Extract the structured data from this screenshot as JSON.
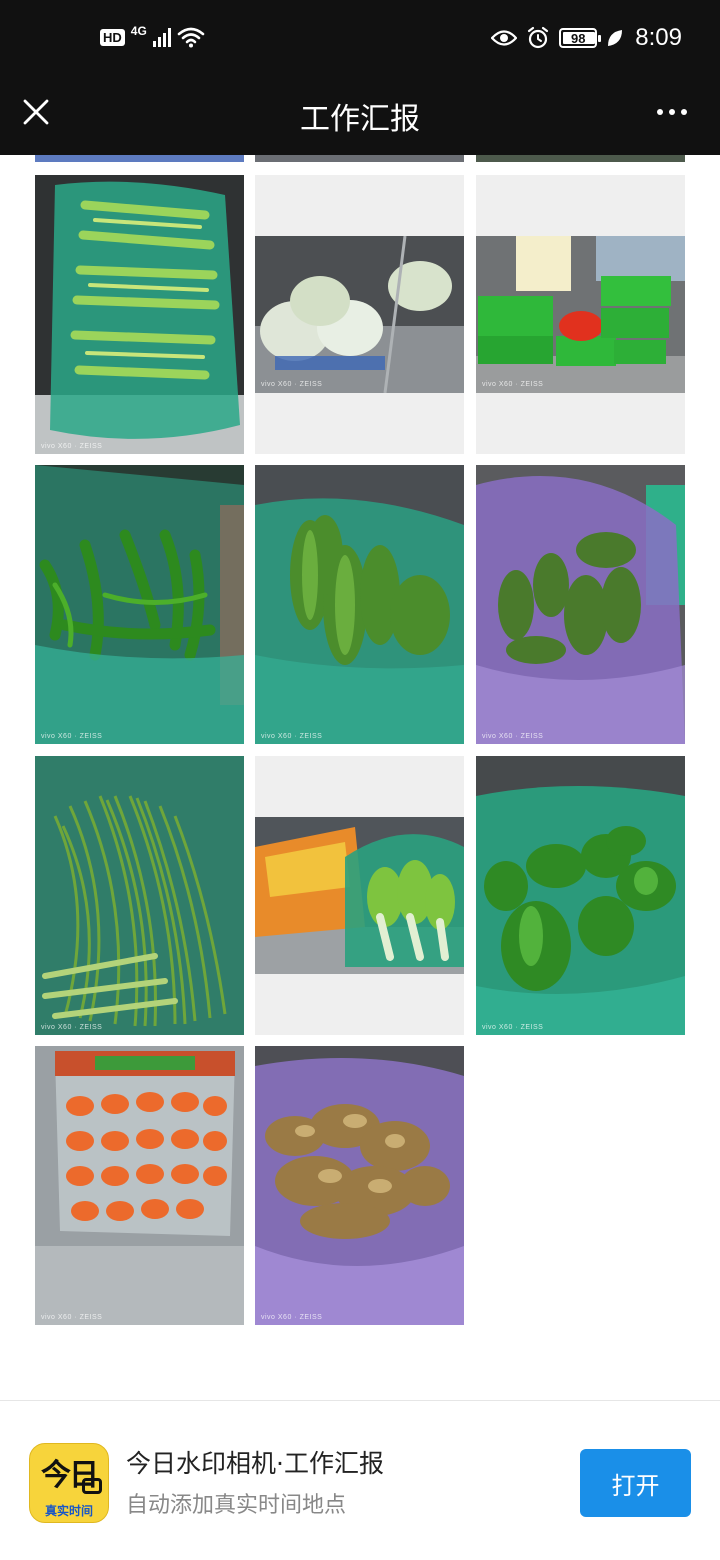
{
  "status_bar": {
    "hd_label": "HD",
    "network": "4G",
    "battery_level": "98",
    "time": "8:09",
    "icons": [
      "signal-icon",
      "wifi-icon",
      "eye-icon",
      "alarm-icon",
      "battery-icon",
      "leaf-icon"
    ]
  },
  "header": {
    "title": "工作汇报",
    "close_icon": "close-icon",
    "more_icon": "more-icon"
  },
  "photos": [
    {
      "subject": "celery",
      "watermark": "vivo X60 · ZEISS"
    },
    {
      "subject": "wrapped-melons",
      "watermark": "vivo X60 · ZEISS"
    },
    {
      "subject": "green-baskets",
      "watermark": "vivo X60 · ZEISS"
    },
    {
      "subject": "green-chili-peppers",
      "watermark": "vivo X60 · ZEISS"
    },
    {
      "subject": "bitter-melons-green-bag",
      "watermark": "vivo X60 · ZEISS"
    },
    {
      "subject": "bitter-melons-purple-bag",
      "watermark": "vivo X60 · ZEISS"
    },
    {
      "subject": "long-beans",
      "watermark": "vivo X60 · ZEISS"
    },
    {
      "subject": "bok-choy",
      "watermark": "vivo X60 · ZEISS"
    },
    {
      "subject": "bell-peppers",
      "watermark": "vivo X60 · ZEISS"
    },
    {
      "subject": "carrots",
      "watermark": "vivo X60 · ZEISS"
    },
    {
      "subject": "ginger",
      "watermark": "vivo X60 · ZEISS"
    }
  ],
  "banner": {
    "app_icon_text": "今日",
    "app_icon_subtext": "真实时间",
    "title": "今日水印相机·工作汇报",
    "subtitle": "自动添加真实时间地点",
    "open_label": "打开"
  },
  "colors": {
    "top_bar": "#111111",
    "accent": "#1a8fe8",
    "app_icon_bg": "#f7d43b"
  }
}
